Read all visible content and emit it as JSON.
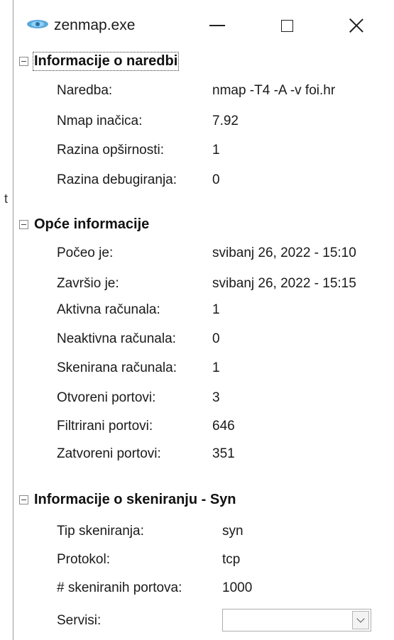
{
  "window": {
    "title": "zenmap.exe",
    "controls": {
      "minimize": "minimize-icon",
      "maximize": "maximize-icon",
      "close": "close-icon"
    }
  },
  "stray_text": "t",
  "sections": [
    {
      "title": "Informacije o naredbi",
      "rows": [
        {
          "label": "Naredba:",
          "value": "nmap -T4 -A -v foi.hr"
        },
        {
          "label": "Nmap inačica:",
          "value": "7.92"
        },
        {
          "label": "Razina opširnosti:",
          "value": "1"
        },
        {
          "label": "Razina debugiranja:",
          "value": "0"
        }
      ]
    },
    {
      "title": "Opće informacije",
      "rows": [
        {
          "label": "Počeo je:",
          "value": "svibanj 26, 2022 - 15:10"
        },
        {
          "label": "Završio je:",
          "value": "svibanj 26, 2022 - 15:15"
        },
        {
          "label": "Aktivna računala:",
          "value": "1"
        },
        {
          "label": "Neaktivna računala:",
          "value": "0"
        },
        {
          "label": "Skenirana računala:",
          "value": "1"
        },
        {
          "label": "Otvoreni portovi:",
          "value": "3"
        },
        {
          "label": "Filtrirani portovi:",
          "value": "646"
        },
        {
          "label": "Zatvoreni portovi:",
          "value": "351"
        }
      ]
    },
    {
      "title": "Informacije o skeniranju - Syn",
      "rows": [
        {
          "label": "Tip skeniranja:",
          "value": "syn"
        },
        {
          "label": "Protokol:",
          "value": "tcp"
        },
        {
          "label": "# skeniranih portova:",
          "value": "1000"
        },
        {
          "label": "Servisi:",
          "value": ""
        }
      ]
    }
  ]
}
